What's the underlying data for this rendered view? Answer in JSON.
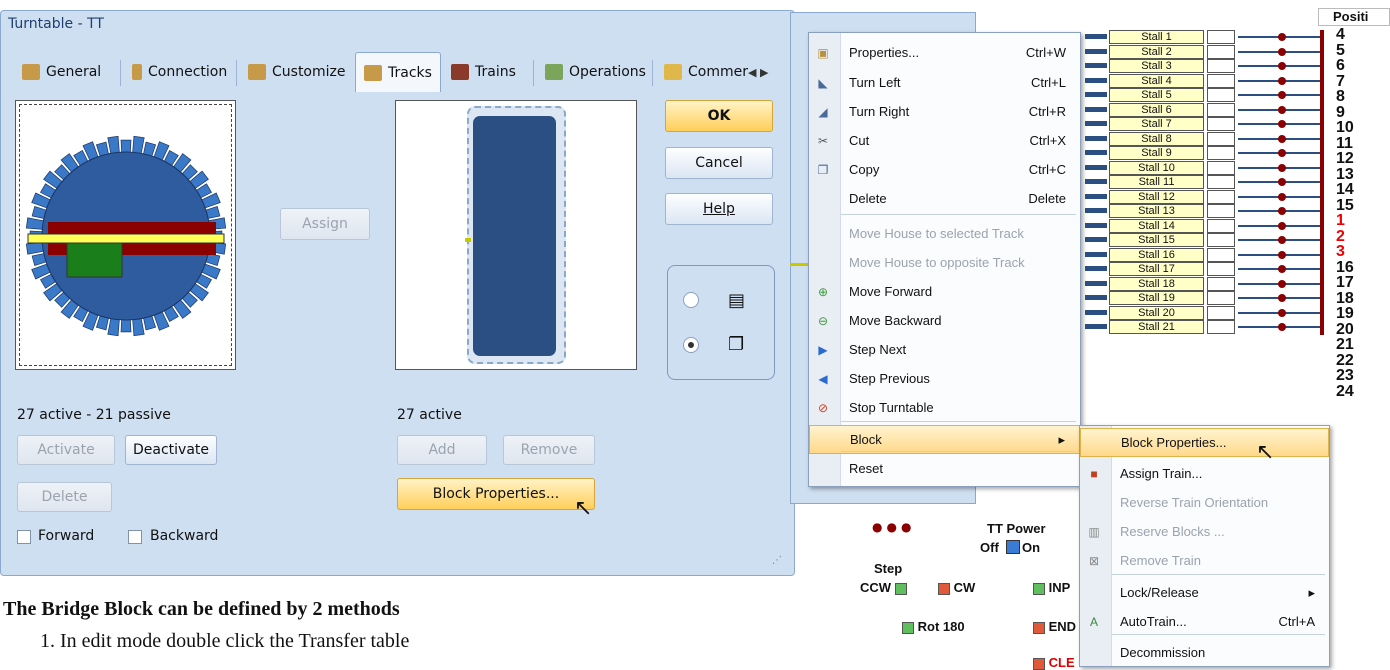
{
  "dialog": {
    "title": "Turntable - TT",
    "tabs": [
      {
        "label": "General"
      },
      {
        "label": "Connection"
      },
      {
        "label": "Customize"
      },
      {
        "label": "Tracks"
      },
      {
        "label": "Trains"
      },
      {
        "label": "Operations"
      },
      {
        "label": "Commer"
      }
    ],
    "ok": "OK",
    "cancel": "Cancel",
    "help": "Help",
    "assign": "Assign",
    "left_status": "27 active - 21 passive",
    "right_status": "27 active",
    "activate": "Activate",
    "deactivate": "Deactivate",
    "delete": "Delete",
    "add": "Add",
    "remove": "Remove",
    "block_properties": "Block Properties...",
    "forward": "Forward",
    "backward": "Backward",
    "scroll_arrows": "◀ ▶"
  },
  "context_menu": {
    "items": [
      {
        "label": "Properties...",
        "shortcut": "Ctrl+W",
        "icon": "properties-icon",
        "enabled": true
      },
      {
        "label": "Turn Left",
        "shortcut": "Ctrl+L",
        "icon": "turn-left-icon",
        "enabled": true
      },
      {
        "label": "Turn Right",
        "shortcut": "Ctrl+R",
        "icon": "turn-right-icon",
        "enabled": true
      },
      {
        "label": "Cut",
        "shortcut": "Ctrl+X",
        "icon": "scissors-icon",
        "enabled": true
      },
      {
        "label": "Copy",
        "shortcut": "Ctrl+C",
        "icon": "copy-icon",
        "enabled": true
      },
      {
        "label": "Delete",
        "shortcut": "Delete",
        "icon": "",
        "enabled": true
      },
      {
        "label": "Move House to selected Track",
        "shortcut": "",
        "icon": "",
        "enabled": false
      },
      {
        "label": "Move House to opposite Track",
        "shortcut": "",
        "icon": "",
        "enabled": false
      },
      {
        "label": "Move Forward",
        "shortcut": "",
        "icon": "move-forward-icon",
        "enabled": true
      },
      {
        "label": "Move Backward",
        "shortcut": "",
        "icon": "move-backward-icon",
        "enabled": true
      },
      {
        "label": "Step Next",
        "shortcut": "",
        "icon": "step-next-icon",
        "enabled": true
      },
      {
        "label": "Step Previous",
        "shortcut": "",
        "icon": "step-previous-icon",
        "enabled": true
      },
      {
        "label": "Stop Turntable",
        "shortcut": "",
        "icon": "stop-icon",
        "enabled": true
      },
      {
        "label": "Block",
        "shortcut": "",
        "icon": "",
        "enabled": true
      },
      {
        "label": "Reset",
        "shortcut": "",
        "icon": "",
        "enabled": true
      }
    ]
  },
  "submenu": {
    "items": [
      {
        "label": "Block Properties...",
        "shortcut": "",
        "enabled": true
      },
      {
        "label": "Assign Train...",
        "shortcut": "",
        "enabled": true
      },
      {
        "label": "Reverse Train Orientation",
        "shortcut": "",
        "enabled": false
      },
      {
        "label": "Reserve Blocks ...",
        "shortcut": "",
        "enabled": false
      },
      {
        "label": "Remove Train",
        "shortcut": "",
        "enabled": false
      },
      {
        "label": "Lock/Release",
        "shortcut": "",
        "enabled": true
      },
      {
        "label": "AutoTrain...",
        "shortcut": "Ctrl+A",
        "enabled": true
      },
      {
        "label": "Decommission",
        "shortcut": "",
        "enabled": true
      }
    ]
  },
  "stalls": [
    "Stall 1",
    "Stall 2",
    "Stall 3",
    "Stall 4",
    "Stall 5",
    "Stall 6",
    "Stall 7",
    "Stall 8",
    "Stall 9",
    "Stall 10",
    "Stall 11",
    "Stall 12",
    "Stall 13",
    "Stall 14",
    "Stall 15",
    "Stall 16",
    "Stall 17",
    "Stall 18",
    "Stall 19",
    "Stall 20",
    "Stall 21"
  ],
  "position_header": "Positi",
  "positions": [
    {
      "n": "4",
      "red": false
    },
    {
      "n": "5",
      "red": false
    },
    {
      "n": "6",
      "red": false
    },
    {
      "n": "7",
      "red": false
    },
    {
      "n": "8",
      "red": false
    },
    {
      "n": "9",
      "red": false
    },
    {
      "n": "10",
      "red": false
    },
    {
      "n": "11",
      "red": false
    },
    {
      "n": "12",
      "red": false
    },
    {
      "n": "13",
      "red": false
    },
    {
      "n": "14",
      "red": false
    },
    {
      "n": "15",
      "red": false
    },
    {
      "n": "1",
      "red": true
    },
    {
      "n": "2",
      "red": true
    },
    {
      "n": "3",
      "red": true
    },
    {
      "n": "16",
      "red": false
    },
    {
      "n": "17",
      "red": false
    },
    {
      "n": "18",
      "red": false
    },
    {
      "n": "19",
      "red": false
    },
    {
      "n": "20",
      "red": false
    },
    {
      "n": "21",
      "red": false
    },
    {
      "n": "22",
      "red": false
    },
    {
      "n": "23",
      "red": false
    },
    {
      "n": "24",
      "red": false
    }
  ],
  "controls": {
    "tt_power": "TT Power",
    "off": "Off",
    "on": "On",
    "step": "Step",
    "ccw": "CCW",
    "cw": "CW",
    "inp": "INP",
    "rot180": "Rot 180",
    "end": "END",
    "cle": "CLE"
  },
  "doc": {
    "heading": "The Bridge Block can be defined by 2 methods",
    "line1": "1. In edit mode double click the Transfer table"
  },
  "colors": {
    "turntable_blue": "#2f5c9e",
    "red": "#8b0000",
    "accent": "#ffd36b"
  }
}
